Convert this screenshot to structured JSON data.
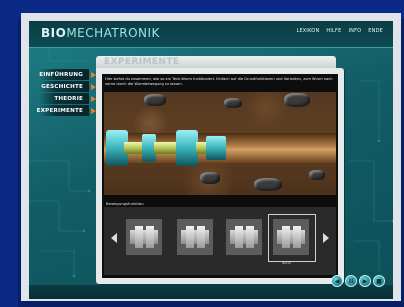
{
  "app": {
    "logo_bold": "BIO",
    "logo_rest": "MECHATRONIK"
  },
  "topnav": [
    "LEXIKON",
    "HILFE",
    "INFO",
    "ENDE"
  ],
  "sidenav": [
    {
      "label": "EINFÜHRUNG"
    },
    {
      "label": "GESCHICHTE"
    },
    {
      "label": "THEORIE"
    },
    {
      "label": "EXPERIMENTE"
    }
  ],
  "panel": {
    "title": "EXPERIMENTE",
    "intro": "Hier siehst du zusammen, wie so ein Tech-Wurm funktioniert. Einfach auf die Grundfunktionen und Varianten, zum Wurm nach vorne durch die Wurmbewegung zu lassen.",
    "segment_label": "Bewegungsfunktion",
    "selection_label": "aktiv"
  },
  "controls": [
    "◀",
    "II",
    "▶",
    "■"
  ],
  "colors": {
    "background": "#0a2a86",
    "app_teal": "#1f7f86",
    "accent_orange": "#f07a2a"
  }
}
